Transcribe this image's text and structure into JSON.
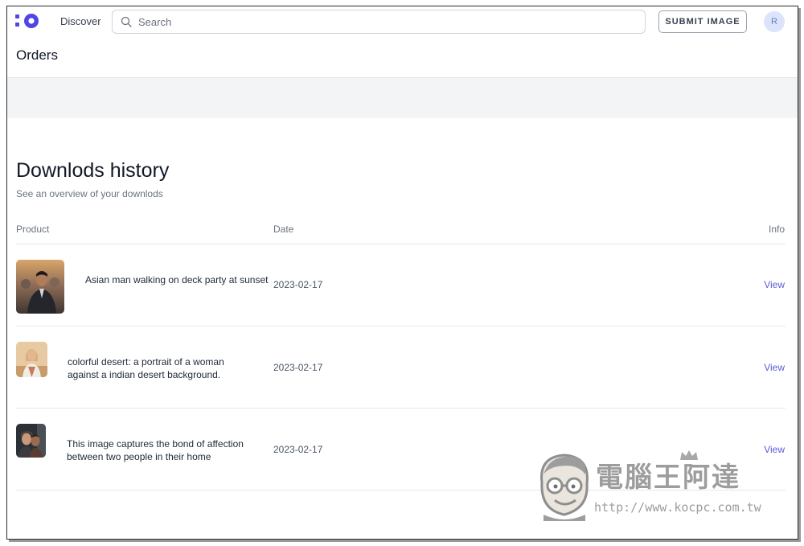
{
  "topbar": {
    "nav_discover": "Discover",
    "search_placeholder": "Search",
    "submit_label": "SUBMIT IMAGE",
    "avatar_initial": "R"
  },
  "page": {
    "title": "Orders"
  },
  "history": {
    "title": "Downlods history",
    "subtitle": "See an overview of your downlods",
    "columns": {
      "product": "Product",
      "date": "Date",
      "info": "Info"
    },
    "rows": [
      {
        "product": "Asian man walking on deck party at sunset",
        "date": "2023-02-17",
        "action": "View"
      },
      {
        "product": "colorful desert: a portrait of a woman against a indian desert background.",
        "date": "2023-02-17",
        "action": "View"
      },
      {
        "product": "This image captures the bond of affection between two people in their home",
        "date": "2023-02-17",
        "action": "View"
      }
    ]
  },
  "watermark": {
    "title": "電腦王阿達",
    "url": "http://www.kocpc.com.tw"
  },
  "colors": {
    "brand": "#4f46e5",
    "link": "#5b5bd6",
    "band": "#f3f4f6"
  }
}
